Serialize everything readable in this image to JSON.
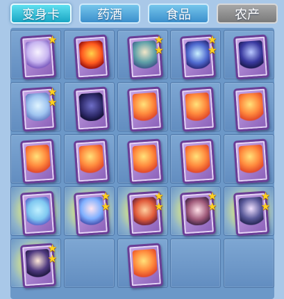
{
  "tabs": [
    {
      "label": "变身卡",
      "state": "active"
    },
    {
      "label": "药酒",
      "state": "normal"
    },
    {
      "label": "食品",
      "state": "normal"
    },
    {
      "label": "农产",
      "state": "disabled"
    }
  ],
  "grid": {
    "slots": [
      {
        "empty": false,
        "icon": "fairy-card-icon",
        "art": "fairy",
        "stars": 1,
        "glow": false
      },
      {
        "empty": false,
        "icon": "fire-spirit-card-icon",
        "art": "fire",
        "stars": 0,
        "glow": false
      },
      {
        "empty": false,
        "icon": "warrior-card-icon",
        "art": "warrior",
        "stars": 2,
        "glow": false
      },
      {
        "empty": false,
        "icon": "serpent-card-icon",
        "art": "serpent",
        "stars": 2,
        "glow": false
      },
      {
        "empty": false,
        "icon": "wizard-card-icon",
        "art": "wizard",
        "stars": 0,
        "glow": false
      },
      {
        "empty": false,
        "icon": "ice-beast-card-icon",
        "art": "beast",
        "stars": 2,
        "glow": false
      },
      {
        "empty": false,
        "icon": "dark-horse-card-icon",
        "art": "horse",
        "stars": 0,
        "glow": false
      },
      {
        "empty": false,
        "icon": "phoenix-card-icon",
        "art": "phoenix",
        "stars": 0,
        "glow": false
      },
      {
        "empty": false,
        "icon": "phoenix-card-icon",
        "art": "phoenix",
        "stars": 0,
        "glow": false
      },
      {
        "empty": false,
        "icon": "phoenix-card-icon",
        "art": "phoenix",
        "stars": 0,
        "glow": false
      },
      {
        "empty": false,
        "icon": "phoenix-card-icon",
        "art": "phoenix",
        "stars": 0,
        "glow": false
      },
      {
        "empty": false,
        "icon": "phoenix-card-icon",
        "art": "phoenix",
        "stars": 0,
        "glow": false
      },
      {
        "empty": false,
        "icon": "phoenix-card-icon",
        "art": "phoenix",
        "stars": 0,
        "glow": false
      },
      {
        "empty": false,
        "icon": "phoenix-card-icon",
        "art": "phoenix",
        "stars": 0,
        "glow": false
      },
      {
        "empty": false,
        "icon": "phoenix-card-icon",
        "art": "phoenix",
        "stars": 0,
        "glow": false
      },
      {
        "empty": false,
        "icon": "ice-dragon-card-icon",
        "art": "dragon",
        "stars": 0,
        "glow": true
      },
      {
        "empty": false,
        "icon": "maiden-card-icon",
        "art": "maiden",
        "stars": 2,
        "glow": true
      },
      {
        "empty": false,
        "icon": "monk-card-icon",
        "art": "monk",
        "stars": 2,
        "glow": true
      },
      {
        "empty": false,
        "icon": "bat-demon-card-icon",
        "art": "bat",
        "stars": 2,
        "glow": true
      },
      {
        "empty": false,
        "icon": "fan-lady-card-icon",
        "art": "fan",
        "stars": 2,
        "glow": true
      },
      {
        "empty": false,
        "icon": "swordsman-card-icon",
        "art": "sword",
        "stars": 2,
        "glow": true
      },
      {
        "empty": true
      },
      {
        "empty": false,
        "icon": "phoenix-card-icon",
        "art": "phoenix",
        "stars": 0,
        "glow": false
      },
      {
        "empty": true
      },
      {
        "empty": true
      }
    ]
  },
  "colors": {
    "background": "#a9c8e8",
    "panel": "#6c98c8",
    "tab_active": "#1aa6c4",
    "tab_normal": "#3b8fcc",
    "tab_disabled": "#7a7a7a",
    "card_frame": "#6a3d96",
    "star": "#ffd21f"
  }
}
